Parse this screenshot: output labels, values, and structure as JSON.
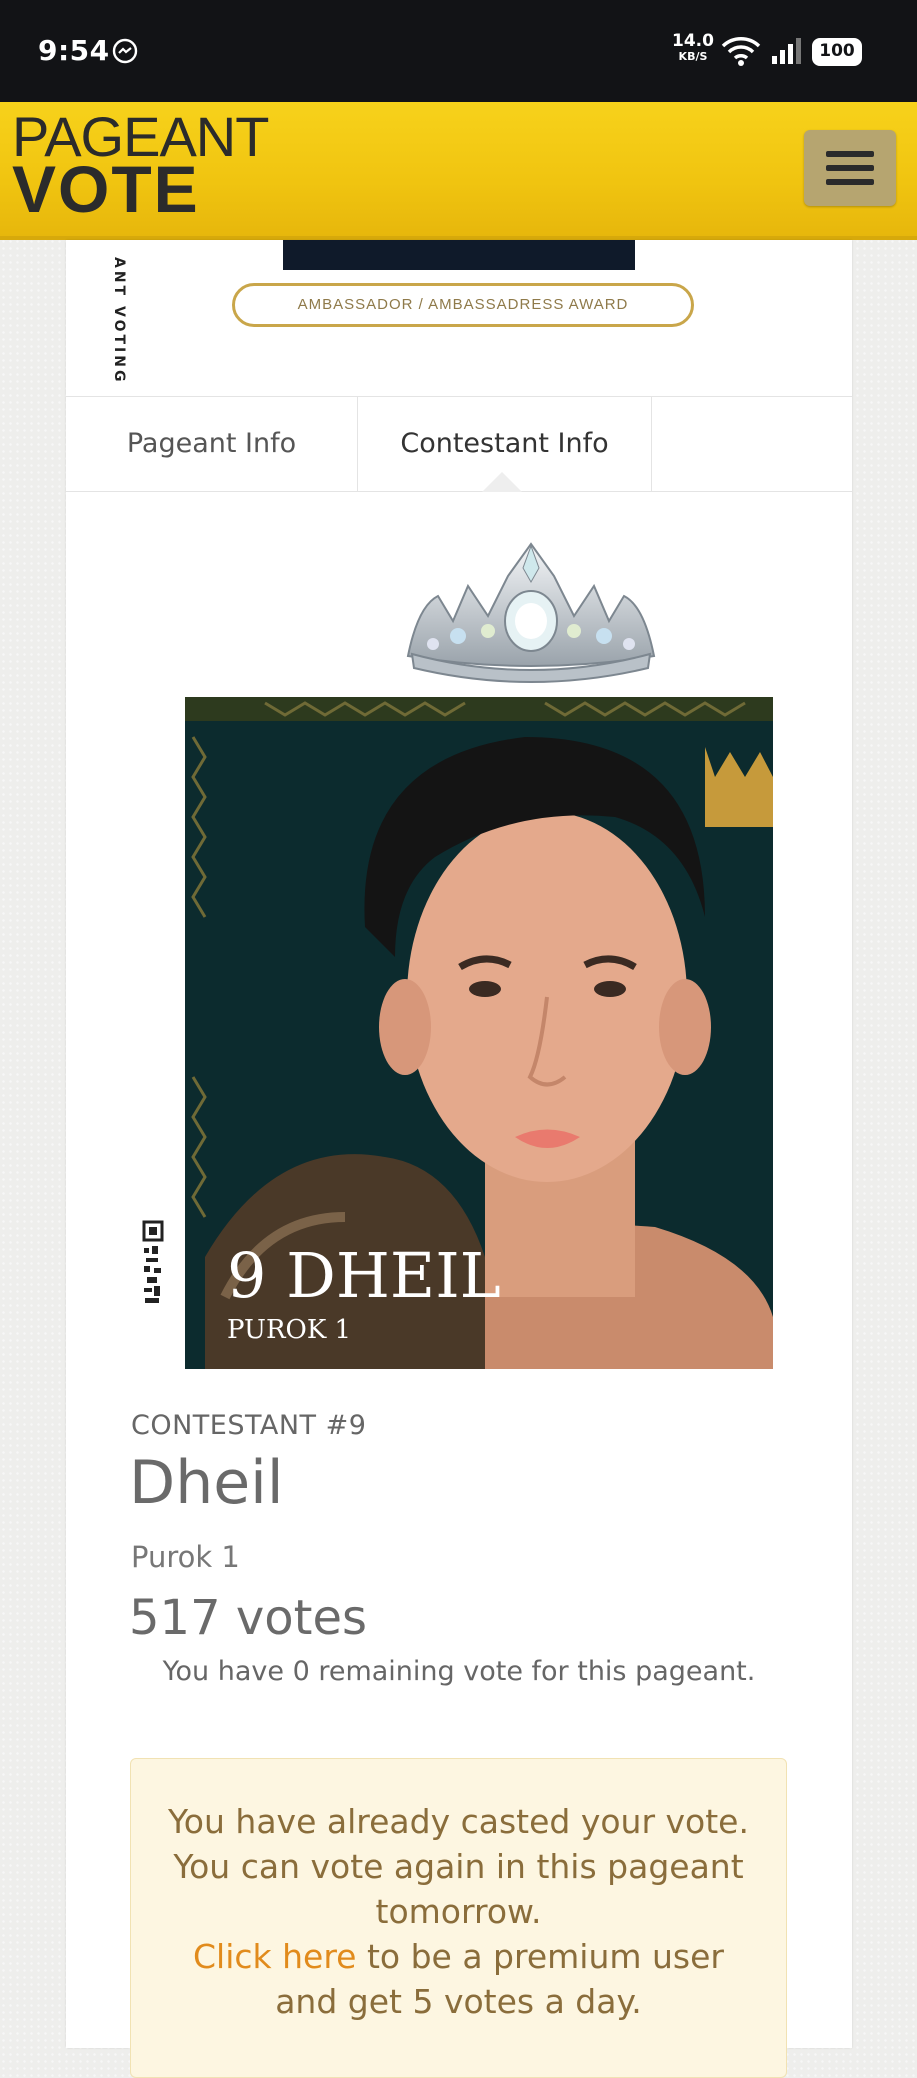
{
  "status_bar": {
    "time": "9:54",
    "net_speed_value": "14.0",
    "net_speed_unit": "KB/S",
    "battery": "100"
  },
  "header": {
    "logo_line1": "PAGEANT",
    "logo_line2": "VOTE",
    "menu_icon": "hamburger-icon"
  },
  "banner": {
    "side_text": "ANT VOTING",
    "award": "AMBASSADOR / AMBASSADRESS  AWARD"
  },
  "tabs": [
    {
      "label": "Pageant Info"
    },
    {
      "label": "Contestant Info"
    }
  ],
  "photo": {
    "caption_name": "9 DHEIL",
    "caption_place": "PUROK 1"
  },
  "contestant": {
    "number_label": "CONTESTANT #9",
    "name": "Dheil",
    "place": "Purok 1",
    "votes": "517 votes",
    "remaining": "You have 0 remaining vote for this pageant."
  },
  "alert": {
    "line1": "You have already casted your vote. You can vote again in this pageant tomorrow.",
    "link": "Click here",
    "line2": " to be a premium user and get 5 votes a day."
  },
  "colors": {
    "header_yellow": "#f0c410",
    "link_orange": "#e18b1c",
    "alert_bg": "#fdf6e1"
  }
}
